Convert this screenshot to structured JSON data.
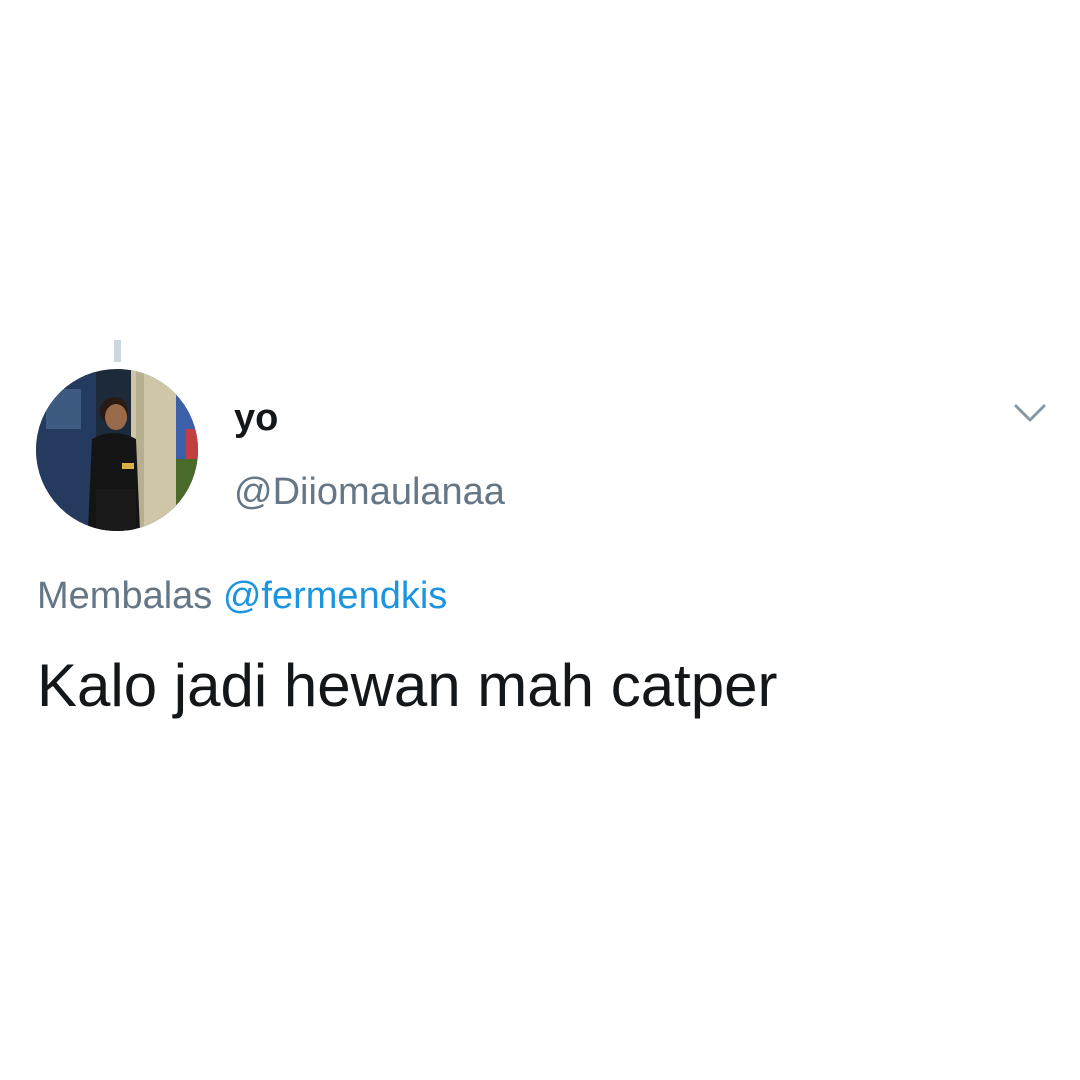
{
  "tweet": {
    "display_name": "yo",
    "handle": "@Diiomaulanaa",
    "reply_prefix": "Membalas",
    "reply_to": "@fermendkis",
    "text": "Kalo jadi hewan mah catper"
  },
  "icons": {
    "menu": "chevron-down-icon"
  },
  "colors": {
    "text_primary": "#14171a",
    "text_secondary": "#657786",
    "link": "#1b95e0",
    "thread_line": "#ccd6dd",
    "background": "#ffffff"
  }
}
